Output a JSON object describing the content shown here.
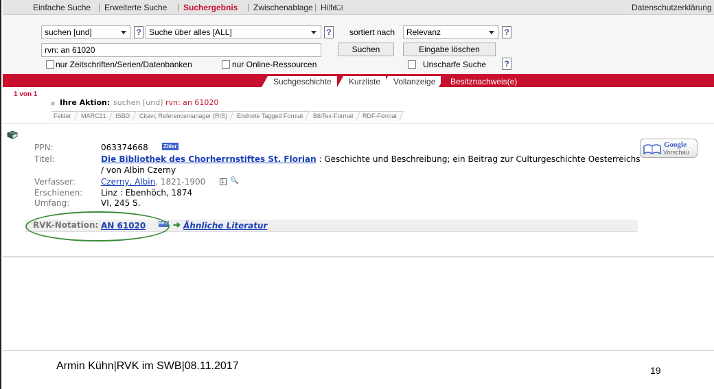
{
  "nav": {
    "items": [
      "Einfache Suche",
      "Erweiterte Suche",
      "Suchergebnis",
      "Zwischenablage",
      "Hilfe"
    ],
    "privacy": "Datenschutzerklärung"
  },
  "search": {
    "operator": "suchen [und]",
    "field": "Suche über alles [ALL]",
    "sort_label": "sortiert nach",
    "sort_value": "Relevanz",
    "query": "rvn: an 61020",
    "search_button": "Suchen",
    "clear_button": "Eingabe löschen",
    "option_journals": "nur Zeitschriften/Serien/Datenbanken",
    "option_online": "nur Online-Ressourcen",
    "option_fuzzy": "Unscharfe Suche",
    "help": "?"
  },
  "subtabs": [
    "Suchgeschichte",
    "Kurzliste",
    "Vollanzeige",
    "Besitznachweis(e)"
  ],
  "result": {
    "hit_count": "1 von 1",
    "action_label": "Ihre Aktion:",
    "action_op": "suchen [und]",
    "action_query": "rvn: an 61020"
  },
  "formats": [
    "Felder",
    "MARC21",
    "ISBD",
    "Citavi, Referencemanager (RIS)",
    "Endnote Tagged Format",
    "BibTex-Format",
    "RDF-Format"
  ],
  "record": {
    "ppn_label": "PPN:",
    "ppn": "063374668",
    "zitier": "Zitier",
    "title_label": "Titel:",
    "title_link": "Die Bibliothek des Chorherrnstiftes St. Florian",
    "title_rest": " : Geschichte und Beschreibung; ein Beitrag zur Culturgeschichte Oesterreichs",
    "title_line2": "/ von Albin Czerny",
    "author_label": "Verfasser:",
    "author": "Czerny, Albin",
    "author_dates": ", 1821-1900",
    "published_label": "Erschienen:",
    "published": "Linz : Ebenhöch, 1874",
    "extent_label": "Umfang:",
    "extent": "VI, 245 S.",
    "rvk_label": "RVK-Notation:",
    "rvk": "AN 61020",
    "info_badge": "INFO",
    "similar": "Ähnliche Literatur"
  },
  "google": {
    "line1": "Google",
    "line2": "Vorschau"
  },
  "footer": {
    "text": "Armin Kühn|RVK im SWB|08.11.2017",
    "page": "19"
  },
  "colors": {
    "accent": "#c8102e",
    "link": "#1a3fb8",
    "highlight": "#3a8a3a"
  }
}
